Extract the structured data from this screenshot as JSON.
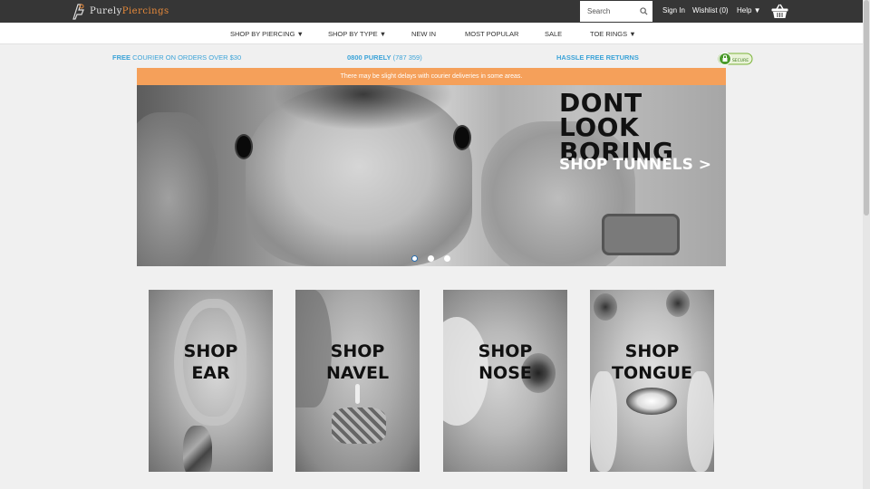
{
  "brand": {
    "part1": "Purely",
    "part2": "Piercings"
  },
  "header": {
    "search_placeholder": "Search",
    "sign_in": "Sign In",
    "wishlist": "Wishlist (0)",
    "help": "Help ▼"
  },
  "nav": {
    "items": [
      {
        "label": "SHOP BY PIERCING ▼"
      },
      {
        "label": "SHOP BY TYPE ▼"
      },
      {
        "label": "NEW IN"
      },
      {
        "label": "MOST POPULAR"
      },
      {
        "label": "SALE"
      },
      {
        "label": "TOE RINGS ▼"
      }
    ]
  },
  "usp": {
    "shipping_bold": "FREE",
    "shipping_rest": " COURIER ON ORDERS OVER $30",
    "phone_bold": "0800 PURELY",
    "phone_rest": " (787 359)",
    "returns": "HASSLE FREE RETURNS",
    "secure_badge": "SECURE"
  },
  "notice": "There may be slight delays with courier deliveries in some areas.",
  "hero": {
    "line1": "DONT LOOK",
    "line2": "BORING",
    "cta": "SHOP TUNNELS >",
    "slide_count": 3,
    "active_slide": 1
  },
  "tiles": [
    {
      "line1": "SHOP",
      "line2": "EAR"
    },
    {
      "line1": "SHOP",
      "line2": "NAVEL"
    },
    {
      "line1": "SHOP",
      "line2": "NOSE"
    },
    {
      "line1": "SHOP",
      "line2": "TONGUE"
    }
  ],
  "colors": {
    "topbar": "#363636",
    "accent_blue": "#3ba3d8",
    "notice_orange": "#f5a05a",
    "logo_orange": "#e88a3a"
  }
}
